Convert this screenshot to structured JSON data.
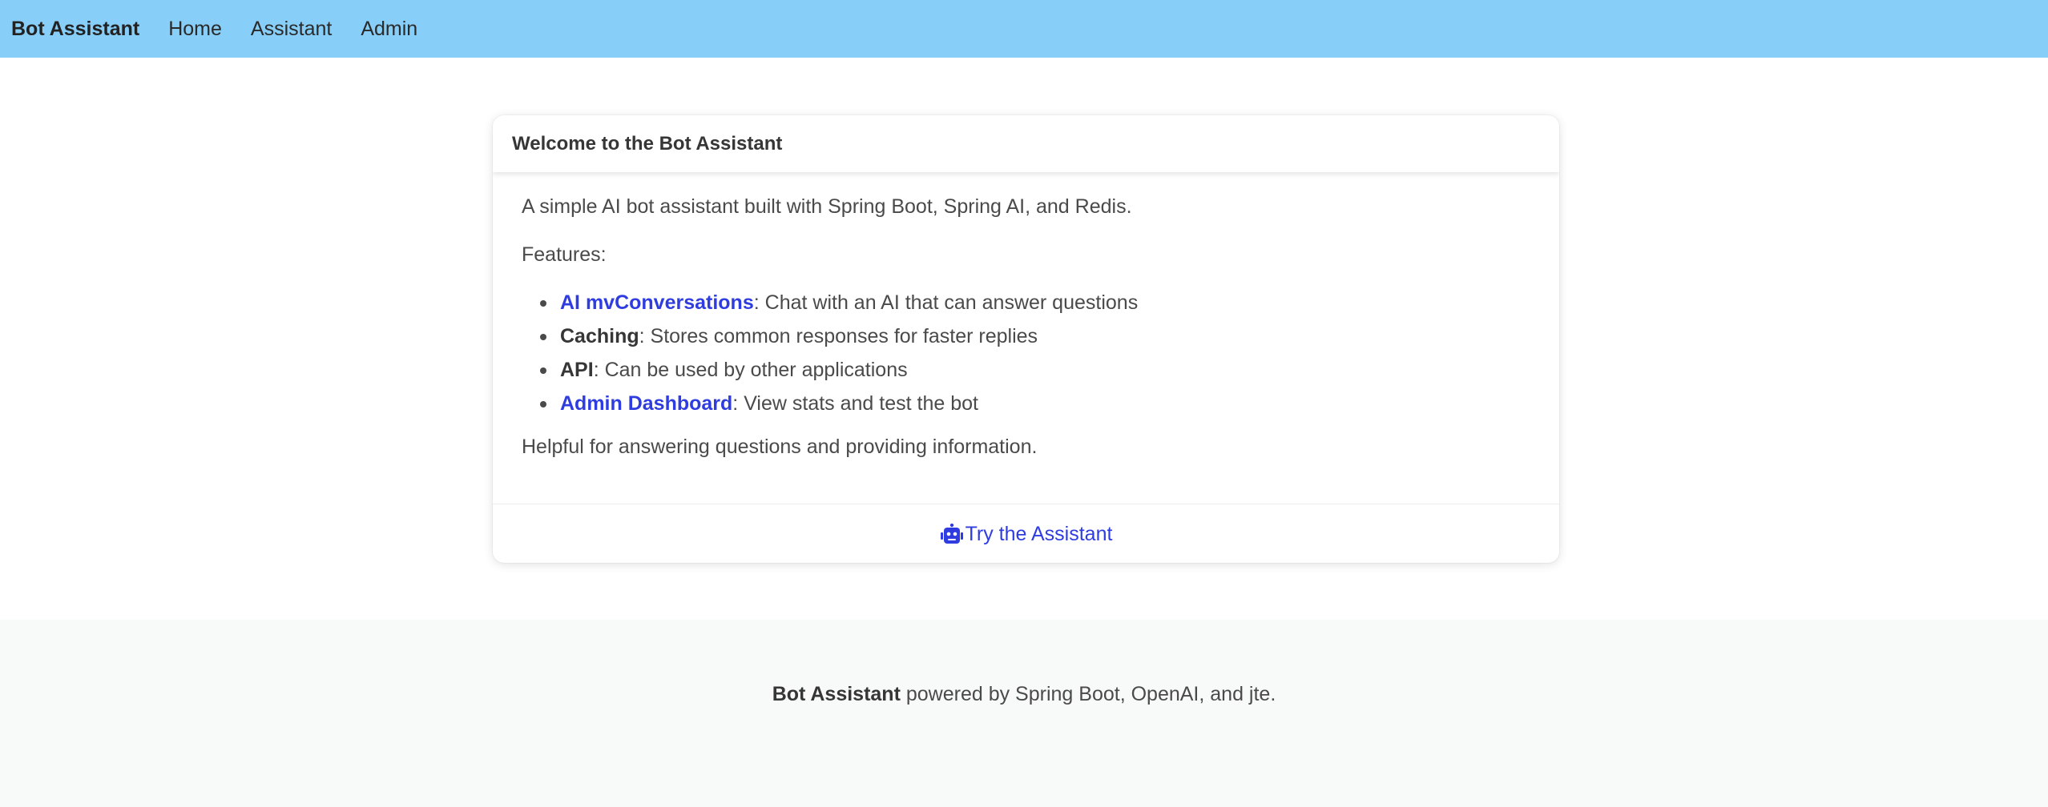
{
  "nav": {
    "brand": "Bot Assistant",
    "items": [
      {
        "label": "Home"
      },
      {
        "label": "Assistant"
      },
      {
        "label": "Admin"
      }
    ]
  },
  "card": {
    "title": "Welcome to the Bot Assistant",
    "intro": "A simple AI bot assistant built with Spring Boot, Spring AI, and Redis.",
    "features_heading": "Features:",
    "features": [
      {
        "name": "AI mvConversations",
        "desc": ": Chat with an AI that can answer questions",
        "is_link": true
      },
      {
        "name": "Caching",
        "desc": ": Stores common responses for faster replies",
        "is_link": false
      },
      {
        "name": "API",
        "desc": ": Can be used by other applications",
        "is_link": false
      },
      {
        "name": "Admin Dashboard",
        "desc": ": View stats and test the bot",
        "is_link": true
      }
    ],
    "closing": "Helpful for answering questions and providing information.",
    "footer_link": {
      "label": "Try the Assistant",
      "icon": "robot-icon"
    }
  },
  "footer": {
    "brand": "Bot Assistant",
    "text": " powered by Spring Boot, OpenAI, and jte."
  },
  "colors": {
    "navbar_bg": "#87cef8",
    "link": "#2f3de0",
    "footer_bg": "#f8f9f9"
  }
}
